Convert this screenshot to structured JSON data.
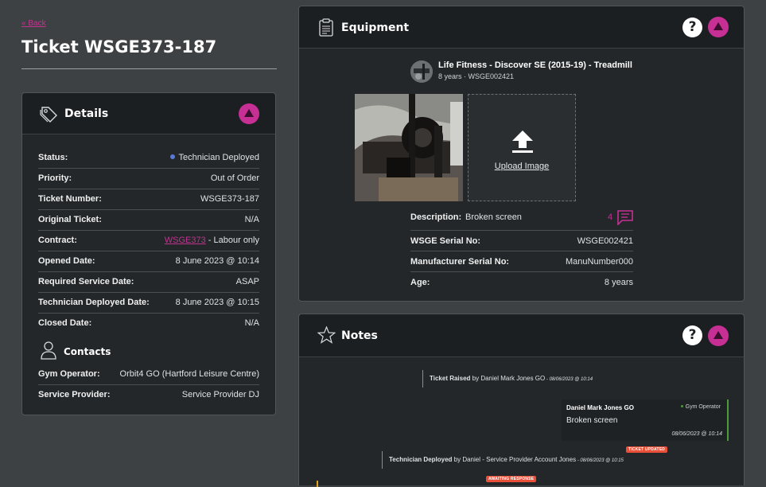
{
  "header": {
    "back_link": "« Back",
    "title": "Ticket WSGE373-187"
  },
  "details": {
    "title": "Details",
    "rows": [
      {
        "label": "Status:",
        "value": "Technician Deployed"
      },
      {
        "label": "Priority:",
        "value": "Out of Order"
      },
      {
        "label": "Ticket Number:",
        "value": "WSGE373-187"
      },
      {
        "label": "Original Ticket:",
        "value": "N/A"
      },
      {
        "label": "Contract:",
        "link": "WSGE373",
        "value": " - Labour only"
      },
      {
        "label": "Opened Date:",
        "value": "8 June 2023 @ 10:14"
      },
      {
        "label": "Required Service Date:",
        "value": "ASAP"
      },
      {
        "label": "Technician Deployed Date:",
        "value": "8 June 2023 @ 10:15"
      },
      {
        "label": "Closed Date:",
        "value": "N/A"
      }
    ],
    "contacts_title": "Contacts",
    "contacts": [
      {
        "label": "Gym Operator:",
        "value": "Orbit4 GO (Hartford Leisure Centre)"
      },
      {
        "label": "Service Provider:",
        "value": "Service Provider DJ"
      }
    ]
  },
  "equipment": {
    "title": "Equipment",
    "help": "?",
    "name": "Life Fitness - Discover SE (2015-19) - Treadmill",
    "subtitle": "8 years · WSGE002421",
    "upload_label": "Upload Image",
    "description_label": "Description:",
    "description_value": "Broken screen",
    "comment_count": "4",
    "rows": [
      {
        "label": "WSGE Serial No:",
        "value": "WSGE002421"
      },
      {
        "label": "Manufacturer Serial No:",
        "value": "ManuNumber000"
      },
      {
        "label": "Age:",
        "value": "8 years"
      }
    ]
  },
  "notes": {
    "title": "Notes",
    "help": "?",
    "event1": {
      "bold": "Ticket Raised",
      "text": " by Daniel Mark Jones GO",
      "date": " - 08/06/2023 @ 10:14"
    },
    "message": {
      "author": "Daniel Mark Jones GO",
      "role": "Gym Operator",
      "body": "Broken screen",
      "date": "08/06/2023 @ 10:14"
    },
    "tag_updated": "TICKET UPDATED",
    "event2": {
      "bold": "Technician Deployed",
      "text": " by Daniel - Service Provider Account Jones",
      "date": " - 08/06/2023 @ 10:15"
    },
    "tag_awaiting": "AWAITING RESPONSE"
  },
  "colors": {
    "accent": "#c62f93",
    "status": "#5a79d6",
    "operator": "#4c9a3a",
    "tag": "#e8503a"
  },
  "icons": [
    "tag-icon",
    "clipboard-icon",
    "star-icon",
    "person-icon",
    "upload-icon",
    "comment-icon",
    "help-icon",
    "collapse-icon"
  ]
}
